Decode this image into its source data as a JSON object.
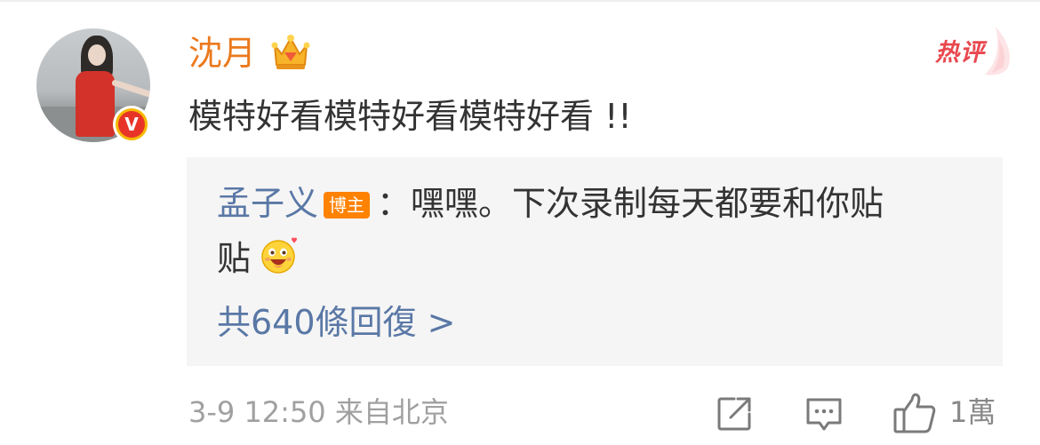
{
  "comment": {
    "user": {
      "name": "沈月",
      "verified_badge": "V"
    },
    "hot_label": "热评",
    "text": "模特好看模特好看模特好看 !!",
    "reply": {
      "author": "孟子义",
      "author_tag": "博主",
      "separator": "：",
      "text_line1": "嘿嘿。下次录制每天都要和你贴",
      "text_line2": "贴",
      "emoji": "grin-emoji",
      "count_label": "共640條回復 >"
    },
    "meta": {
      "time": "3-9 12:50",
      "source": "来自北京"
    },
    "actions": {
      "like_count": "1萬"
    }
  },
  "colors": {
    "username": "#eb7a1e",
    "link_blue": "#5a78a6",
    "hot_red": "#e8474e",
    "badge_orange": "#ff8200",
    "text_gray": "#a0a0a0",
    "reply_bg": "#f5f5f5"
  },
  "icons": [
    "vip-crown-icon",
    "verified-badge-icon",
    "share-icon",
    "comment-icon",
    "like-icon"
  ]
}
